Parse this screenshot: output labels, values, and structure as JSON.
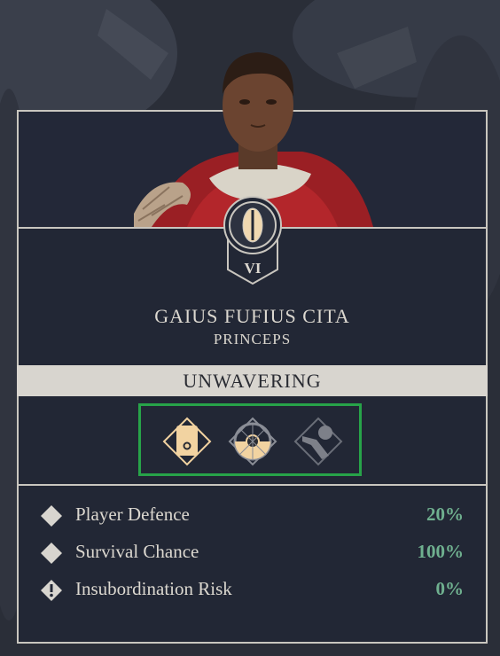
{
  "unit": {
    "name": "GAIUS FUFIUS CITA",
    "title": "PRINCEPS",
    "rank": "VI",
    "trait": "UNWAVERING"
  },
  "abilities": [
    {
      "icon": "shield-diamond-icon",
      "state": "active"
    },
    {
      "icon": "round-shield-icon",
      "state": "partial"
    },
    {
      "icon": "weapon-arm-icon",
      "state": "inactive"
    }
  ],
  "stats": [
    {
      "label": "Player Defence",
      "value": "20%",
      "icon": "diamond-icon"
    },
    {
      "label": "Survival Chance",
      "value": "100%",
      "icon": "diamond-icon"
    },
    {
      "label": "Insubordination Risk",
      "value": "0%",
      "icon": "warning-diamond-icon"
    }
  ],
  "colors": {
    "panel": "#222735",
    "border": "#c9c6bf",
    "stat_value": "#6fb08f",
    "highlight": "#27a349",
    "ability_active": "#f2d3a1"
  }
}
